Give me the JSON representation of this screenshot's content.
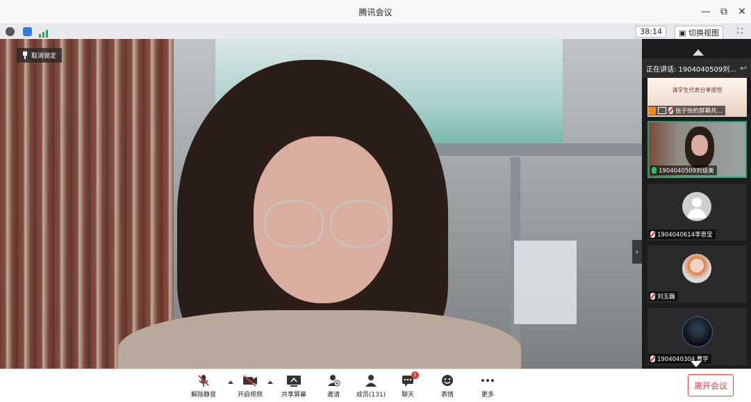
{
  "window": {
    "title": "腾讯会议",
    "controls": {
      "minimize": "—",
      "restore": "⧉",
      "close": "✕"
    }
  },
  "statusbar": {
    "timer": "38:14",
    "switch_view": "切换视图"
  },
  "main_video": {
    "unlock_label": "取消锁定"
  },
  "sidebar": {
    "speaking": "正在讲话: 1904040509刘...",
    "share_tile": {
      "thumb_title": "请学生代表分享感悟",
      "label": "张子怡的屏幕共..."
    },
    "tiles": [
      {
        "label": "1904040509刘佳美"
      },
      {
        "label": "1904040614李思莹"
      },
      {
        "label": "刘玉巍"
      },
      {
        "label": "1904040304 曹宇"
      }
    ]
  },
  "toolbar": {
    "unmute": "解除静音",
    "video": "开启视频",
    "share": "共享屏幕",
    "invite": "邀请",
    "members": "成员(131)",
    "chat": "聊天",
    "chat_badge": "1",
    "reactions": "表情",
    "more": "更多",
    "leave": "离开会议"
  },
  "colors": {
    "accent_green": "#2da36a",
    "leave_red": "#e04545",
    "badge_red": "#e03b3b"
  }
}
